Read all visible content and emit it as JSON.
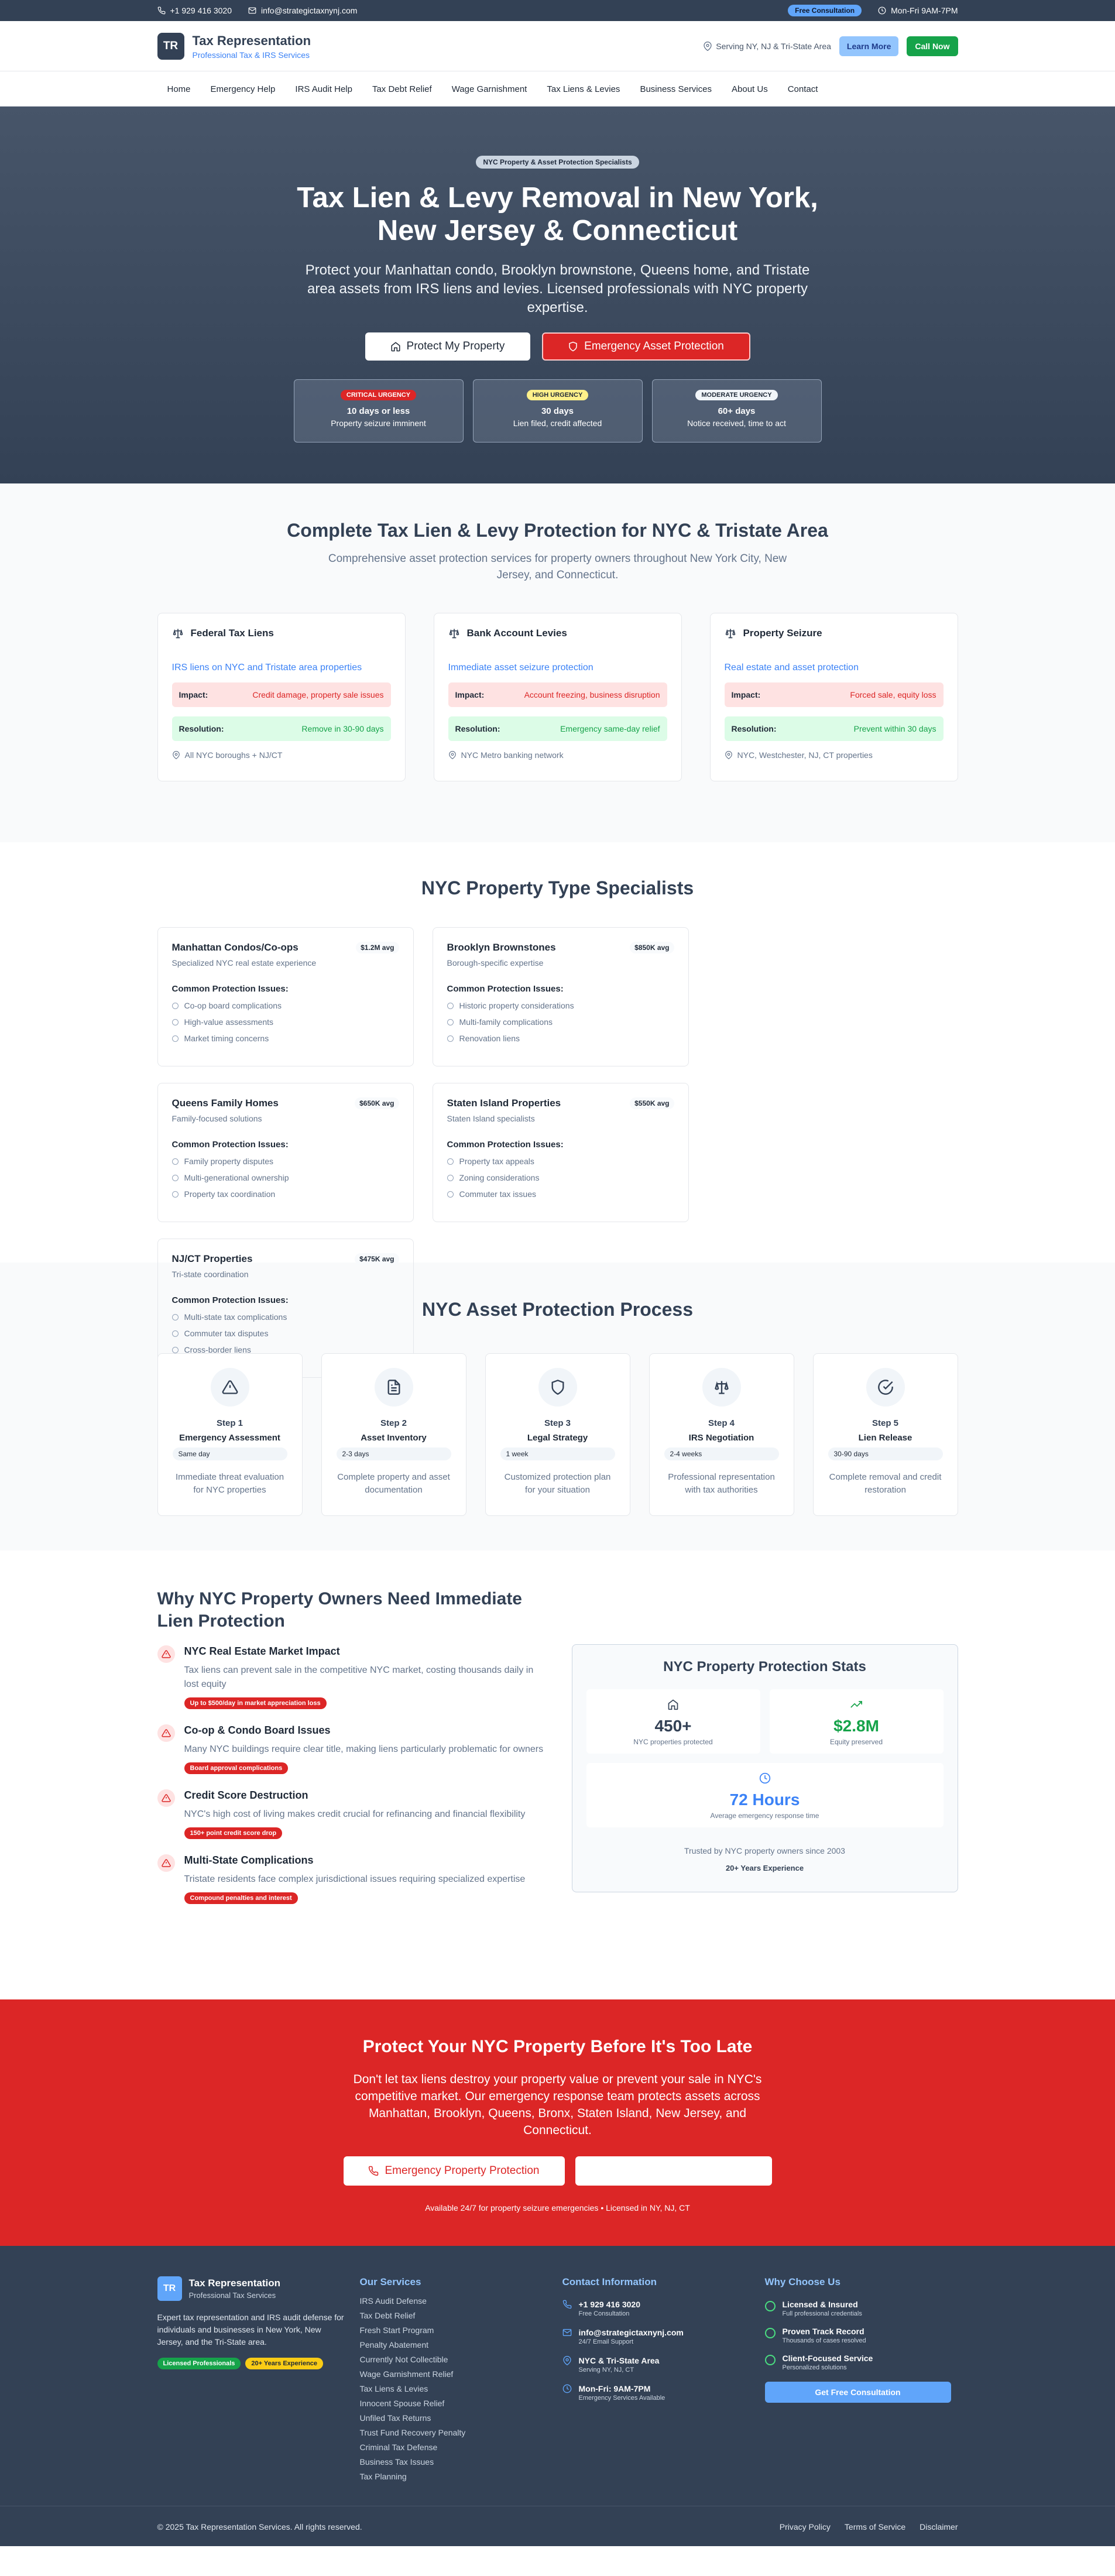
{
  "topbar": {
    "phone": "+1 929 416 3020",
    "email": "info@strategictaxnynj.com",
    "badge": "Free Consultation",
    "hours": "Mon-Fri 9AM-7PM"
  },
  "header": {
    "logo": "TR",
    "name": "Tax Representation",
    "tagline": "Professional Tax & IRS Services",
    "serving": "Serving NY, NJ & Tri-State Area",
    "learn_more": "Learn More",
    "call_now": "Call Now"
  },
  "nav": [
    "Home",
    "Emergency Help",
    "IRS Audit Help",
    "Tax Debt Relief",
    "Wage Garnishment",
    "Tax Liens & Levies",
    "Business Services",
    "About Us",
    "Contact"
  ],
  "hero": {
    "badge": "NYC Property & Asset Protection Specialists",
    "title": "Tax Lien & Levy Removal in New York, New Jersey & Connecticut",
    "subtitle": "Protect your Manhattan condo, Brooklyn brownstone, Queens home, and Tristate area assets from IRS liens and levies. Licensed professionals with NYC property expertise.",
    "btn_protect": "Protect My Property",
    "btn_emergency": "Emergency Asset Protection",
    "urgency": [
      {
        "badge": "CRITICAL URGENCY",
        "line1": "10 days or less",
        "line2": "Property seizure imminent",
        "badge_bg": "#dc2626",
        "badge_color": "#ffffff"
      },
      {
        "badge": "HIGH URGENCY",
        "line1": "30 days",
        "line2": "Lien filed, credit affected",
        "badge_bg": "#fef08a",
        "badge_color": "#1f2937"
      },
      {
        "badge": "MODERATE URGENCY",
        "line1": "60+ days",
        "line2": "Notice received, time to act",
        "badge_bg": "#f1f5f9",
        "badge_color": "#1f2937"
      }
    ]
  },
  "protection": {
    "title": "Complete Tax Lien & Levy Protection for NYC & Tristate Area",
    "subtitle": "Comprehensive asset protection services for property owners throughout New York City, New Jersey, and Connecticut.",
    "impact_label": "Impact:",
    "resolution_label": "Resolution:",
    "cards": [
      {
        "title": "Federal Tax Liens",
        "desc": "IRS liens on NYC and Tristate area properties",
        "impact": "Credit damage, property sale issues",
        "resolution": "Remove in 30-90 days",
        "location": "All NYC boroughs + NJ/CT"
      },
      {
        "title": "Bank Account Levies",
        "desc": "Immediate asset seizure protection",
        "impact": "Account freezing, business disruption",
        "resolution": "Emergency same-day relief",
        "location": "NYC Metro banking network"
      },
      {
        "title": "Property Seizure",
        "desc": "Real estate and asset protection",
        "impact": "Forced sale, equity loss",
        "resolution": "Prevent within 30 days",
        "location": "NYC, Westchester, NJ, CT properties"
      }
    ]
  },
  "property_types": {
    "title": "NYC Property Type Specialists",
    "issues_label": "Common Protection Issues:",
    "cards": [
      {
        "title": "Manhattan Condos/Co-ops",
        "price": "$1.2M avg",
        "sub": "Specialized NYC real estate experience",
        "issues": [
          "Co-op board complications",
          "High-value assessments",
          "Market timing concerns"
        ]
      },
      {
        "title": "Brooklyn Brownstones",
        "price": "$850K avg",
        "sub": "Borough-specific expertise",
        "issues": [
          "Historic property considerations",
          "Multi-family complications",
          "Renovation liens"
        ]
      },
      {
        "title": "Queens Family Homes",
        "price": "$650K avg",
        "sub": "Family-focused solutions",
        "issues": [
          "Family property disputes",
          "Multi-generational ownership",
          "Property tax coordination"
        ]
      },
      {
        "title": "Staten Island Properties",
        "price": "$550K avg",
        "sub": "Staten Island specialists",
        "issues": [
          "Property tax appeals",
          "Zoning considerations",
          "Commuter tax issues"
        ]
      },
      {
        "title": "NJ/CT Properties",
        "price": "$475K avg",
        "sub": "Tri-state coordination",
        "issues": [
          "Multi-state tax complications",
          "Commuter tax disputes",
          "Cross-border liens"
        ]
      }
    ]
  },
  "process": {
    "title": "NYC Asset Protection Process",
    "steps": [
      {
        "step": "Step 1",
        "title": "Emergency Assessment",
        "time": "Same day",
        "desc": "Immediate threat evaluation for NYC properties",
        "icon": "alert-triangle-icon"
      },
      {
        "step": "Step 2",
        "title": "Asset Inventory",
        "time": "2-3 days",
        "desc": "Complete property and asset documentation",
        "icon": "document-icon"
      },
      {
        "step": "Step 3",
        "title": "Legal Strategy",
        "time": "1 week",
        "desc": "Customized protection plan for your situation",
        "icon": "shield-icon"
      },
      {
        "step": "Step 4",
        "title": "IRS Negotiation",
        "time": "2-4 weeks",
        "desc": "Professional representation with tax authorities",
        "icon": "scale-icon"
      },
      {
        "step": "Step 5",
        "title": "Lien Release",
        "time": "30-90 days",
        "desc": "Complete removal and credit restoration",
        "icon": "check-circle-icon"
      }
    ]
  },
  "why": {
    "title": "Why NYC Property Owners Need Immediate Lien Protection",
    "items": [
      {
        "title": "NYC Real Estate Market Impact",
        "desc": "Tax liens can prevent sale in the competitive NYC market, costing thousands daily in lost equity",
        "badge": "Up to $500/day in market appreciation loss"
      },
      {
        "title": "Co-op & Condo Board Issues",
        "desc": "Many NYC buildings require clear title, making liens particularly problematic for owners",
        "badge": "Board approval complications"
      },
      {
        "title": "Credit Score Destruction",
        "desc": "NYC's high cost of living makes credit crucial for refinancing and financial flexibility",
        "badge": "150+ point credit score drop"
      },
      {
        "title": "Multi-State Complications",
        "desc": "Tristate residents face complex jurisdictional issues requiring specialized expertise",
        "badge": "Compound penalties and interest"
      }
    ],
    "stats": {
      "title": "NYC Property Protection Stats",
      "s1_num": "450+",
      "s1_label": "NYC properties protected",
      "s2_num": "$2.8M",
      "s2_label": "Equity preserved",
      "s3_num": "72 Hours",
      "s3_label": "Average emergency response time",
      "footer": "Trusted by NYC property owners since 2003",
      "footer_badge": "20+ Years Experience"
    }
  },
  "cta": {
    "title": "Protect Your NYC Property Before It's Too Late",
    "text": "Don't let tax liens destroy your property value or prevent your sale in NYC's competitive market. Our emergency response team protects assets across Manhattan, Brooklyn, Queens, Bronx, Staten Island, New Jersey, and Connecticut.",
    "btn1": "Emergency Property Protection",
    "note": "Available 24/7 for property seizure emergencies • Licensed in NY, NJ, CT"
  },
  "footer": {
    "logo": "TR",
    "name": "Tax Representation",
    "sub": "Professional Tax Services",
    "desc": "Expert tax representation and IRS audit defense for individuals and businesses in New York, New Jersey, and the Tri-State area.",
    "badge1": "Licensed Professionals",
    "badge2": "20+ Years Experience",
    "services_title": "Our Services",
    "services": [
      "IRS Audit Defense",
      "Tax Debt Relief",
      "Fresh Start Program",
      "Penalty Abatement",
      "Currently Not Collectible",
      "Wage Garnishment Relief",
      "Tax Liens & Levies",
      "Innocent Spouse Relief",
      "Unfiled Tax Returns",
      "Trust Fund Recovery Penalty",
      "Criminal Tax Defense",
      "Business Tax Issues",
      "Tax Planning"
    ],
    "contact_title": "Contact Information",
    "contact": [
      {
        "main": "+1 929 416 3020",
        "sub": "Free Consultation",
        "icon": "phone-icon"
      },
      {
        "main": "info@strategictaxnynj.com",
        "sub": "24/7 Email Support",
        "icon": "mail-icon"
      },
      {
        "main": "NYC & Tri-State Area",
        "sub": "Serving NY, NJ, CT",
        "icon": "map-pin-icon"
      },
      {
        "main": "Mon-Fri: 9AM-7PM",
        "sub": "Emergency Services Available",
        "icon": "clock-icon"
      }
    ],
    "why_title": "Why Choose Us",
    "why": [
      {
        "title": "Licensed & Insured",
        "sub": "Full professional credentials"
      },
      {
        "title": "Proven Track Record",
        "sub": "Thousands of cases resolved"
      },
      {
        "title": "Client-Focused Service",
        "sub": "Personalized solutions"
      }
    ],
    "btn": "Get Free Consultation",
    "copyright": "© 2025 Tax Representation Services. All rights reserved.",
    "legal": [
      "Privacy Policy",
      "Terms of Service",
      "Disclaimer"
    ]
  }
}
